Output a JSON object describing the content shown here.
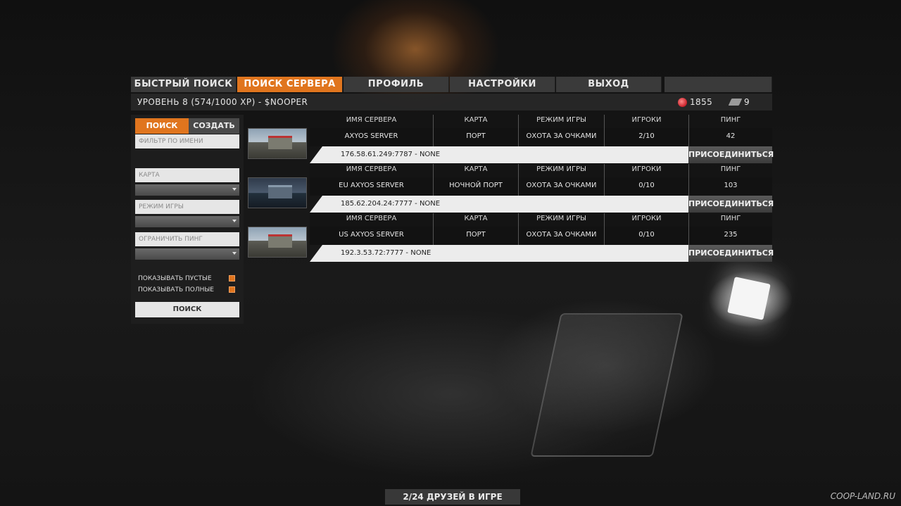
{
  "tabs": [
    {
      "label": "БЫСТРЫЙ ПОИСК",
      "active": false
    },
    {
      "label": "ПОИСК СЕРВЕРА",
      "active": true
    },
    {
      "label": "ПРОФИЛЬ",
      "active": false
    },
    {
      "label": "НАСТРОЙКИ",
      "active": false
    },
    {
      "label": "ВЫХОД",
      "active": false
    }
  ],
  "player": {
    "info": "УРОВЕНЬ 8 (574/1000 XP) - $NOOPER",
    "gems": "1855",
    "chips": "9"
  },
  "left_panel": {
    "tab_search": "ПОИСК",
    "tab_create": "СОЗДАТЬ",
    "filter_name_placeholder": "ФИЛЬТР ПО ИМЕНИ",
    "map_placeholder": "КАРТА",
    "game_mode_placeholder": "РЕЖИМ ИГРЫ",
    "ping_limit_placeholder": "ОГРАНИЧИТЬ ПИНГ",
    "show_empty": "ПОКАЗЫВАТЬ ПУСТЫЕ",
    "show_full": "ПОКАЗЫВАТЬ ПОЛНЫЕ",
    "search_button": "ПОИСК"
  },
  "columns": {
    "name": "ИМЯ СЕРВЕРА",
    "map": "КАРТА",
    "mode": "РЕЖИМ ИГРЫ",
    "players": "ИГРОКИ",
    "ping": "ПИНГ"
  },
  "servers": [
    {
      "name": "AXYOS SERVER",
      "map": "ПОРТ",
      "mode": "ОХОТА ЗА ОЧКАМИ",
      "players": "2/10",
      "ping": "42",
      "address": "176.58.61.249:7787 - NONE",
      "join": "ПРИСОЕДИНИТЬСЯ"
    },
    {
      "name": "EU AXYOS SERVER",
      "map": "НОЧНОЙ ПОРТ",
      "mode": "ОХОТА ЗА ОЧКАМИ",
      "players": "0/10",
      "ping": "103",
      "address": "185.62.204.24:7777 - NONE",
      "join": "ПРИСОЕДИНИТЬСЯ"
    },
    {
      "name": "US AXYOS SERVER",
      "map": "ПОРТ",
      "mode": "ОХОТА ЗА ОЧКАМИ",
      "players": "0/10",
      "ping": "235",
      "address": "192.3.53.72:7777 - NONE",
      "join": "ПРИСОЕДИНИТЬСЯ"
    }
  ],
  "friends": "2/24 ДРУЗЕЙ В ИГРЕ",
  "watermark": "COOP-LAND.RU",
  "colors": {
    "accent": "#e0751e",
    "panel": "#3a3a3a"
  }
}
